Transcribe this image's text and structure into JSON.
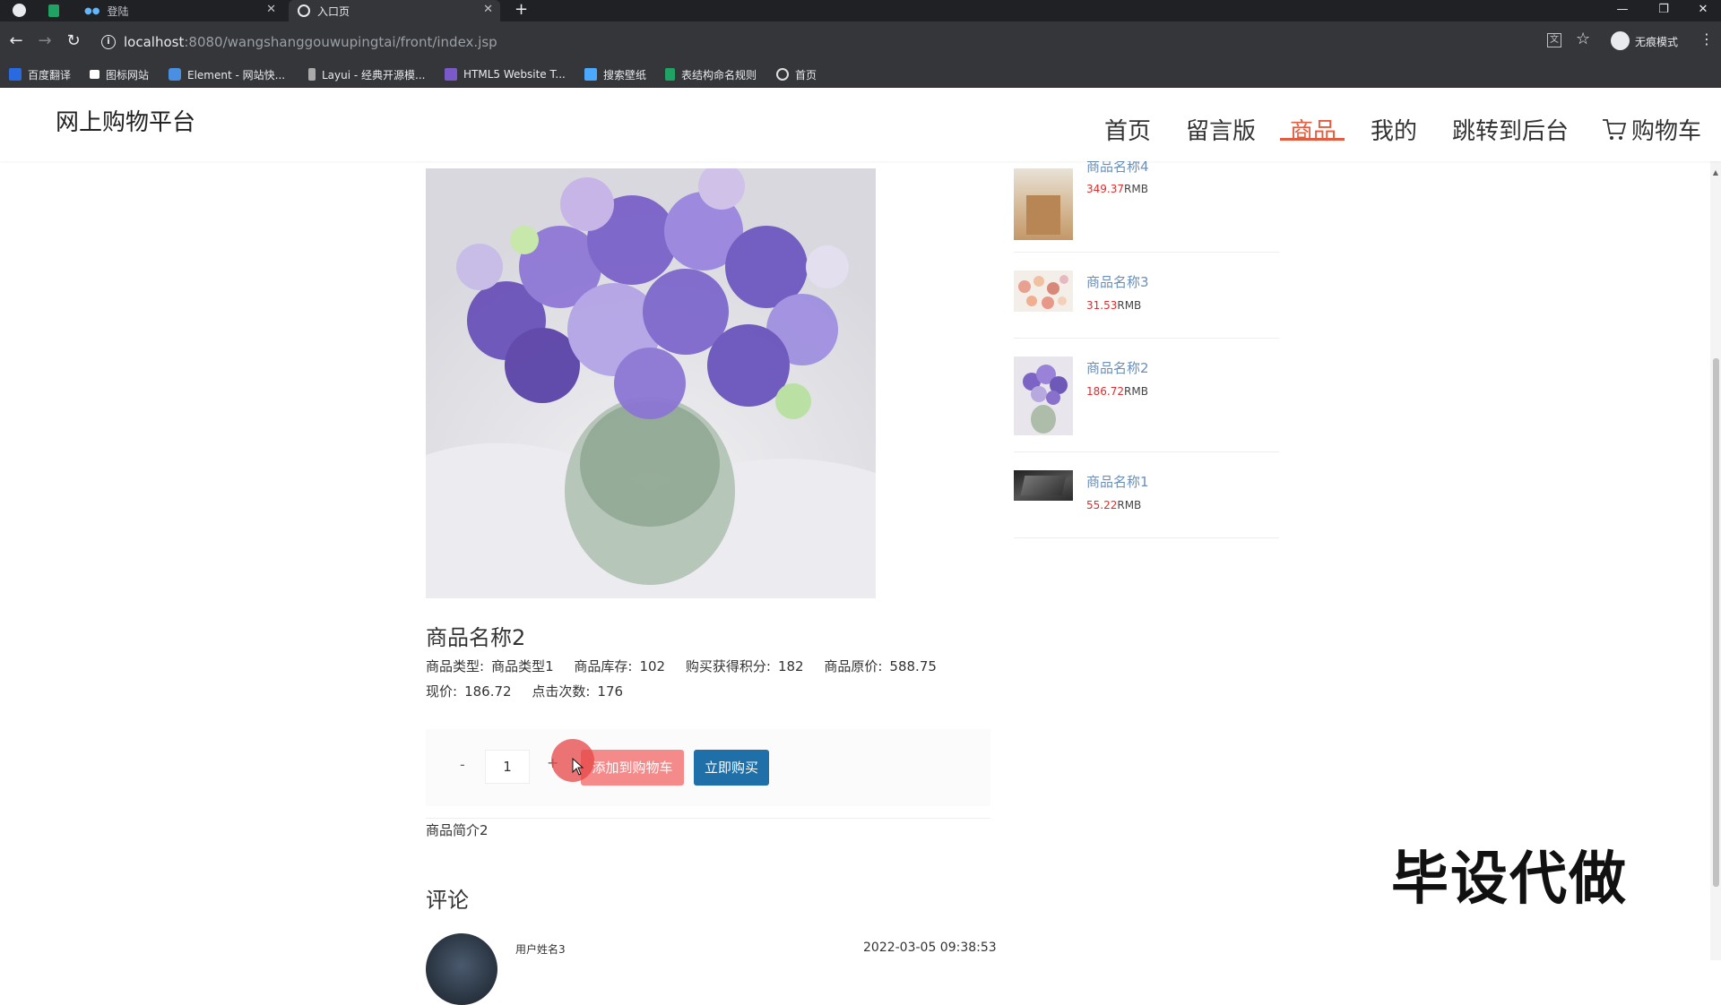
{
  "browser": {
    "tabs": [
      {
        "label": "登陆",
        "active": false
      },
      {
        "label": "入口页",
        "active": true
      }
    ],
    "new_tab_symbol": "+",
    "url_host": "localhost",
    "url_path": ":8080/wangshanggouwupingtai/front/index.jsp",
    "incognito_label": "无痕模式",
    "bookmarks": [
      {
        "label": "百度翻译",
        "icon": "baidu-translate-icon",
        "color": "#2a6ae0"
      },
      {
        "label": "图标网站",
        "icon": "flag-icon",
        "color": "#ffffff"
      },
      {
        "label": "Element - 网站快...",
        "icon": "element-icon",
        "color": "#4a90e2"
      },
      {
        "label": "Layui - 经典开源模...",
        "icon": "layui-icon",
        "color": "#aaaaaa"
      },
      {
        "label": "HTML5 Website T...",
        "icon": "html5-icon",
        "color": "#7a5ac8"
      },
      {
        "label": "搜索壁纸",
        "icon": "wallpaper-icon",
        "color": "#4aa8ff"
      },
      {
        "label": "表结构命名规则",
        "icon": "sheet-icon",
        "color": "#1ea362"
      },
      {
        "label": "首页",
        "icon": "globe-icon",
        "color": "#dddddd"
      }
    ]
  },
  "site": {
    "logo": "网上购物平台",
    "nav": [
      {
        "label": "首页",
        "active": false
      },
      {
        "label": "留言版",
        "active": false
      },
      {
        "label": "商品",
        "active": true
      },
      {
        "label": "我的",
        "active": false
      },
      {
        "label": "跳转到后台",
        "active": false
      },
      {
        "label": "购物车",
        "active": false
      }
    ],
    "accent_color": "#e45c3f"
  },
  "product": {
    "title": "商品名称2",
    "type_label": "商品类型:",
    "type_value": "商品类型1",
    "stock_label": "商品库存:",
    "stock_value": "102",
    "points_label": "购买获得积分:",
    "points_value": "182",
    "original_price_label": "商品原价:",
    "original_price_value": "588.75",
    "price_label": "现价:",
    "price_value": "186.72",
    "clicks_label": "点击次数:",
    "clicks_value": "176",
    "intro": "商品简介2"
  },
  "actions": {
    "minus": "-",
    "quantity": "1",
    "plus": "+",
    "add_to_cart": "添加到购物车",
    "buy_now": "立即购买",
    "add_to_cart_color": "#f58a8a",
    "buy_now_color": "#1f6fa8"
  },
  "comments": {
    "heading": "评论",
    "items": [
      {
        "user": "用户姓名3",
        "date": "2022-03-05 09:38:53"
      }
    ]
  },
  "sidebar": {
    "items": [
      {
        "name": "商品名称4",
        "price": "349.37",
        "unit": "RMB"
      },
      {
        "name": "商品名称3",
        "price": "31.53",
        "unit": "RMB"
      },
      {
        "name": "商品名称2",
        "price": "186.72",
        "unit": "RMB"
      },
      {
        "name": "商品名称1",
        "price": "55.22",
        "unit": "RMB"
      }
    ]
  },
  "watermark": "毕设代做"
}
